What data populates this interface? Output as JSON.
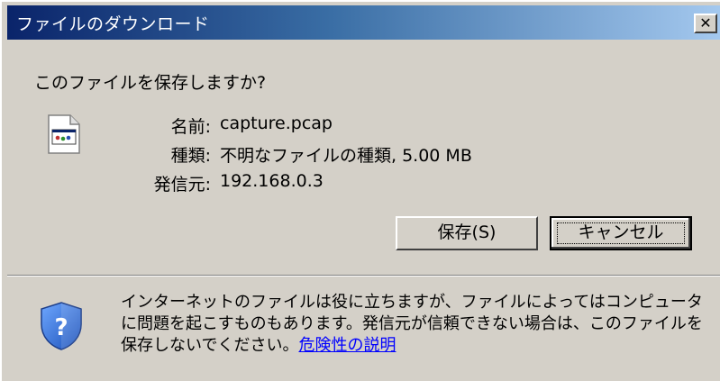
{
  "window": {
    "title": "ファイルのダウンロード",
    "close_label": "✕"
  },
  "dialog": {
    "question": "このファイルを保存しますか?",
    "fields": {
      "name_label": "名前:",
      "name_value": "capture.pcap",
      "type_label": "種類:",
      "type_value": "不明なファイルの種類, 5.00 MB",
      "from_label": "発信元:",
      "from_value": "192.168.0.3"
    },
    "buttons": {
      "save": "保存(S)",
      "cancel": "キャンセル"
    }
  },
  "warning": {
    "text": "インターネットのファイルは役に立ちますが、ファイルによってはコンピュータに問題を起こすものもあります。発信元が信頼できない場合は、このファイルを保存しないでください。",
    "link": "危険性の説明"
  },
  "colors": {
    "title_start": "#0a246a",
    "title_end": "#a6caf0",
    "face": "#d4d0c8",
    "link": "#0000ff"
  },
  "icons": {
    "file": "generic-file-icon",
    "warning": "shield-question-icon"
  }
}
